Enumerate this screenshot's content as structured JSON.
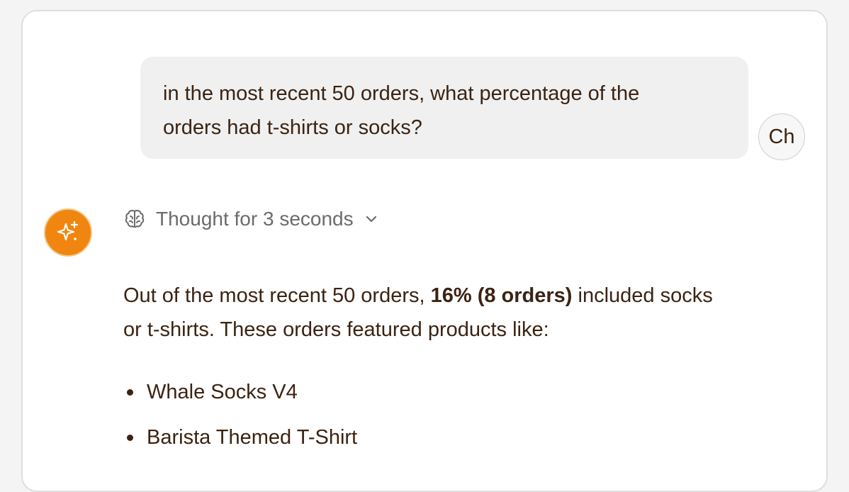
{
  "colors": {
    "assistant_avatar_bg": "#f0860f",
    "text": "#3b2313",
    "muted_text": "#6b6b6b",
    "user_bubble_bg": "#f0f0f0"
  },
  "user_message": {
    "line1": "in the most recent 50 orders, what percentage of the",
    "line2": "orders had t-shirts or socks?",
    "avatar_initials": "Ch"
  },
  "assistant": {
    "avatar_icon": "sparkles-icon",
    "thought": {
      "icon": "brain-icon",
      "label": "Thought for 3 seconds",
      "toggle_icon": "chevron-down-icon"
    },
    "answer": {
      "intro": "Out of the most recent 50 orders, ",
      "highlight": "16% (8 orders)",
      "rest_line1": " included socks",
      "line2": "or t-shirts. These orders featured products like:"
    },
    "products": [
      {
        "label": "Whale Socks V4"
      },
      {
        "label": "Barista Themed T-Shirt"
      }
    ]
  }
}
